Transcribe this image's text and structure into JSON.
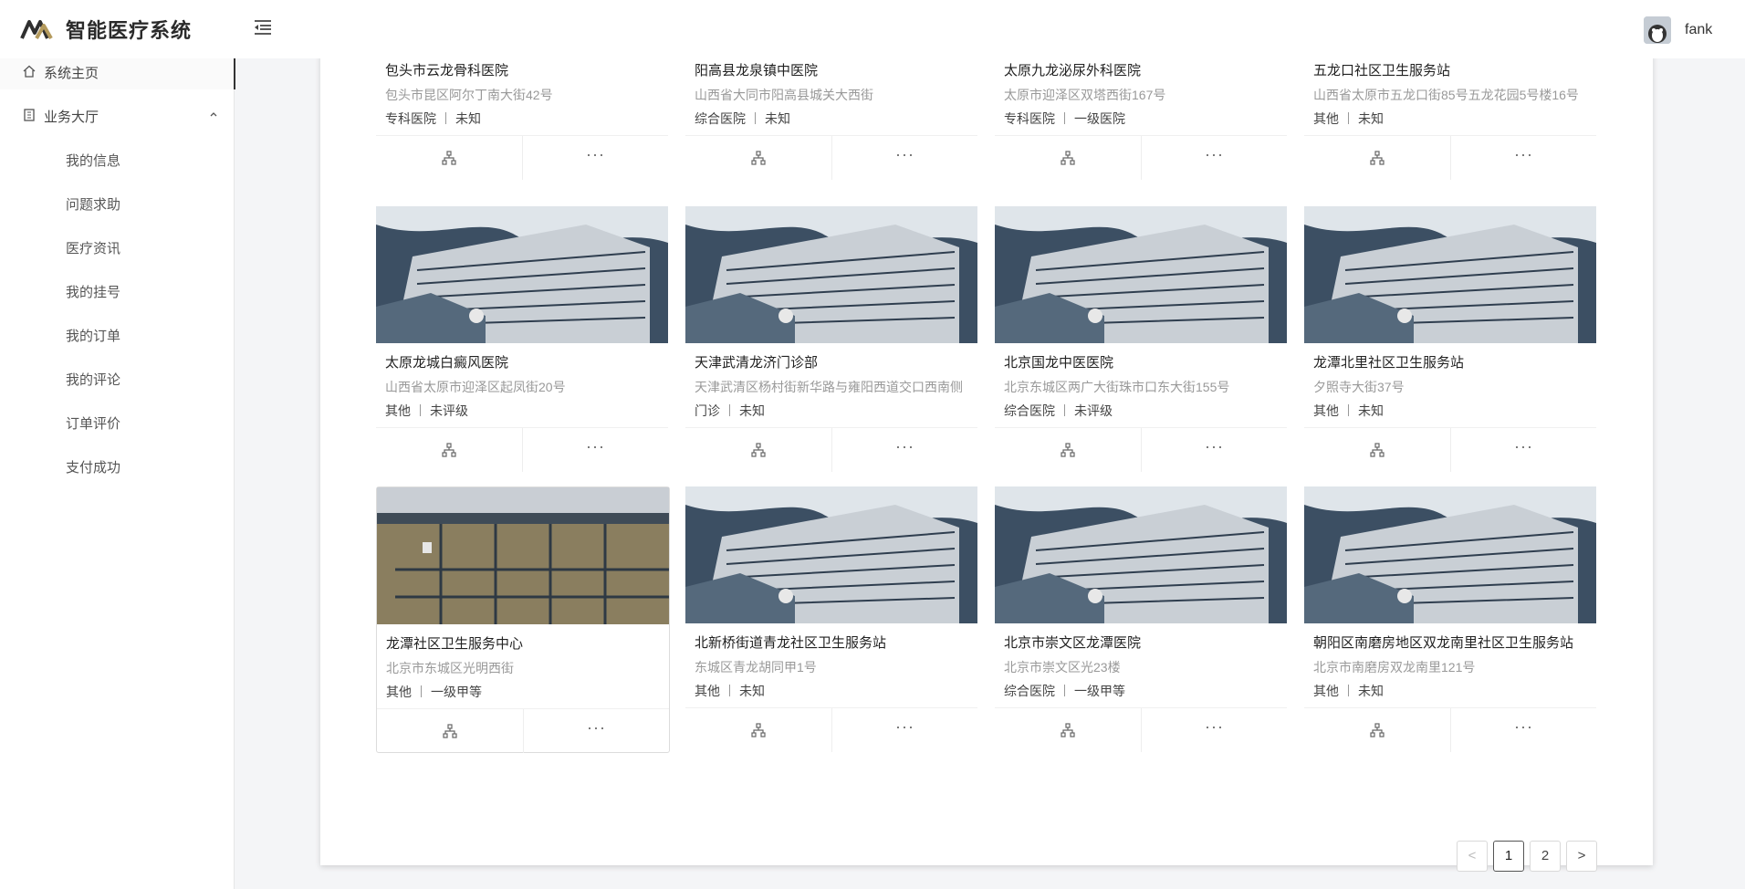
{
  "app": {
    "title": "智能医疗系统"
  },
  "user": {
    "name": "fank"
  },
  "sidebar": {
    "home": "系统主页",
    "hall": "业务大厅",
    "items": [
      "我的信息",
      "问题求助",
      "医疗资讯",
      "我的挂号",
      "我的订单",
      "我的评论",
      "订单评价",
      "支付成功"
    ]
  },
  "hospitals": [
    {
      "name": "包头市云龙骨科医院",
      "address": "包头市昆区阿尔丁南大街42号",
      "type": "专科医院",
      "level": "未知"
    },
    {
      "name": "阳高县龙泉镇中医院",
      "address": "山西省大同市阳高县城关大西街",
      "type": "综合医院",
      "level": "未知"
    },
    {
      "name": "太原九龙泌尿外科医院",
      "address": "太原市迎泽区双塔西街167号",
      "type": "专科医院",
      "level": "一级医院"
    },
    {
      "name": "五龙口社区卫生服务站",
      "address": "山西省太原市五龙口街85号五龙花园5号楼16号",
      "type": "其他",
      "level": "未知"
    },
    {
      "name": "太原龙城白癜风医院",
      "address": "山西省太原市迎泽区起凤街20号",
      "type": "其他",
      "level": "未评级"
    },
    {
      "name": "天津武清龙济门诊部",
      "address": "天津武清区杨村街新华路与雍阳西道交口西南侧",
      "type": "门诊",
      "level": "未知"
    },
    {
      "name": "北京国龙中医医院",
      "address": "北京东城区两广大街珠市口东大街155号",
      "type": "综合医院",
      "level": "未评级"
    },
    {
      "name": "龙潭北里社区卫生服务站",
      "address": "夕照寺大街37号",
      "type": "其他",
      "level": "未知"
    },
    {
      "name": "龙潭社区卫生服务中心",
      "address": "北京市东城区光明西街",
      "type": "其他",
      "level": "一级甲等"
    },
    {
      "name": "北新桥街道青龙社区卫生服务站",
      "address": "东城区青龙胡同甲1号",
      "type": "其他",
      "level": "未知"
    },
    {
      "name": "北京市崇文区龙潭医院",
      "address": "北京市崇文区光23楼",
      "type": "综合医院",
      "level": "一级甲等"
    },
    {
      "name": "朝阳区南磨房地区双龙南里社区卫生服务站",
      "address": "北京市南磨房双龙南里121号",
      "type": "其他",
      "level": "未知"
    }
  ],
  "card_actions": {
    "more": "···"
  },
  "pagination": {
    "prev": "<",
    "pages": [
      "1",
      "2"
    ],
    "next": ">",
    "current": "1"
  },
  "colors": {
    "accent": "#333333",
    "background": "#f4f5f7",
    "panel": "#ffffff",
    "muted_text": "#999999"
  }
}
